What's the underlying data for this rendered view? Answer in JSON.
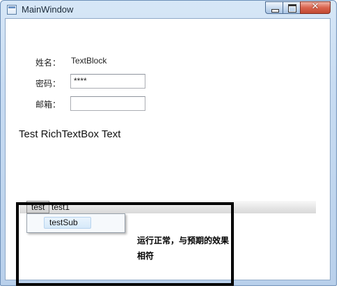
{
  "window": {
    "title": "MainWindow",
    "controls": {
      "minimize": "minimize",
      "maximize": "maximize",
      "close": "x"
    }
  },
  "form": {
    "name_label": "姓名：",
    "name_value": "TextBlock",
    "password_label": "密码：",
    "password_value": "****",
    "email_label": "邮箱：",
    "email_value": ""
  },
  "richtext": "Test RichTextBox Text",
  "menu": {
    "items": [
      {
        "label": "test"
      },
      {
        "label": "test1"
      }
    ],
    "submenu": [
      {
        "label": "testSub"
      }
    ]
  },
  "annotation": "运行正常，与预期的效果相符"
}
